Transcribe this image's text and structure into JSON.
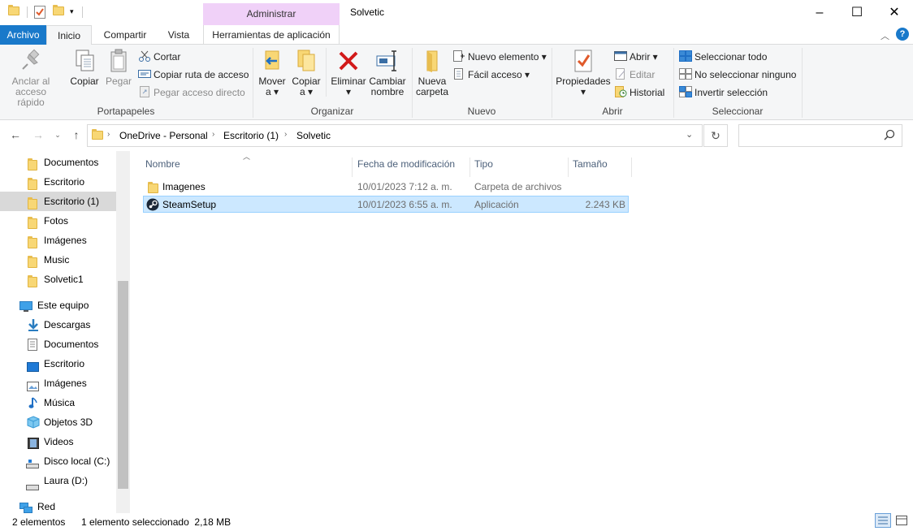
{
  "window": {
    "title": "Solvetic",
    "contextual_header": "Administrar"
  },
  "tabs": {
    "archivo": "Archivo",
    "inicio": "Inicio",
    "compartir": "Compartir",
    "vista": "Vista",
    "herramientas": "Herramientas de aplicación"
  },
  "ribbon": {
    "portapapeles": {
      "label": "Portapapeles",
      "anclar": [
        "Anclar al",
        "acceso rápido"
      ],
      "copiar": "Copiar",
      "pegar": "Pegar",
      "cortar": "Cortar",
      "copiar_ruta": "Copiar ruta de acceso",
      "pegar_acceso": "Pegar acceso directo"
    },
    "organizar": {
      "label": "Organizar",
      "mover": [
        "Mover",
        "a ▾"
      ],
      "copiar_a": [
        "Copiar",
        "a ▾"
      ],
      "eliminar": [
        "Eliminar",
        "▾"
      ],
      "cambiar": [
        "Cambiar",
        "nombre"
      ]
    },
    "nuevo": {
      "label": "Nuevo",
      "nueva_carpeta": [
        "Nueva",
        "carpeta"
      ],
      "nuevo_elemento": "Nuevo elemento ▾",
      "facil_acceso": "Fácil acceso ▾"
    },
    "abrir": {
      "label": "Abrir",
      "propiedades": [
        "Propiedades",
        "▾"
      ],
      "abrir": "Abrir ▾",
      "editar": "Editar",
      "historial": "Historial"
    },
    "seleccionar": {
      "label": "Seleccionar",
      "todo": "Seleccionar todo",
      "ninguno": "No seleccionar ninguno",
      "invertir": "Invertir selección"
    }
  },
  "address": {
    "crumbs": [
      "OneDrive - Personal",
      "Escritorio (1)",
      "Solvetic"
    ],
    "search_placeholder": ""
  },
  "nav": {
    "onedrive_items": [
      "Documentos",
      "Escritorio",
      "Escritorio (1)",
      "Fotos",
      "Imágenes",
      "Music",
      "Solvetic1"
    ],
    "este_equipo": "Este equipo",
    "pc_items": [
      "Descargas",
      "Documentos",
      "Escritorio",
      "Imágenes",
      "Música",
      "Objetos 3D",
      "Videos",
      "Disco local (C:)",
      "Laura  (D:)"
    ],
    "red": "Red"
  },
  "columns": {
    "nombre": "Nombre",
    "fecha": "Fecha de modificación",
    "tipo": "Tipo",
    "tamano": "Tamaño"
  },
  "files": [
    {
      "name": "Imagenes",
      "date": "10/01/2023 7:12 a. m.",
      "type": "Carpeta de archivos",
      "size": ""
    },
    {
      "name": "SteamSetup",
      "date": "10/01/2023 6:55 a. m.",
      "type": "Aplicación",
      "size": "2.243 KB"
    }
  ],
  "status": {
    "count": "2 elementos",
    "selection": "1 elemento seleccionado  2,18 MB"
  }
}
